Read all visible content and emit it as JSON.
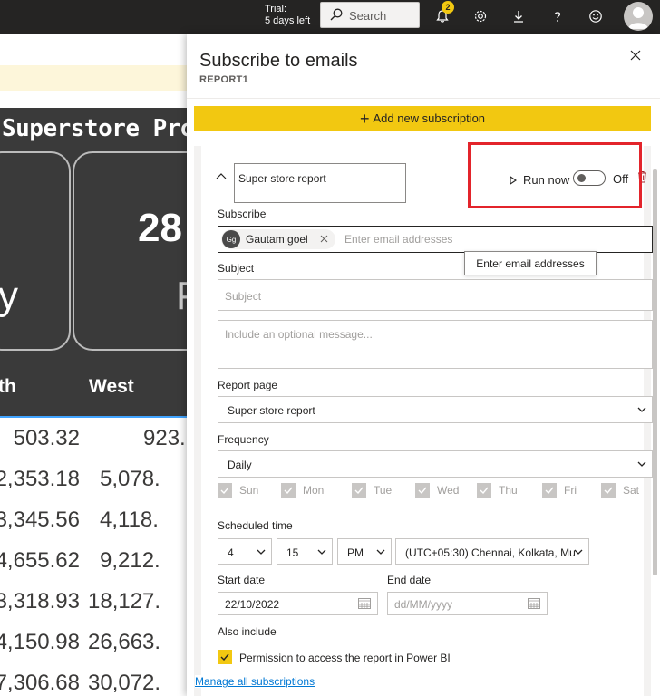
{
  "topbar": {
    "trial_line1": "Trial:",
    "trial_line2": "5 days left",
    "search_label": "Search",
    "notification_count": "2",
    "icons": [
      "bell-icon",
      "gear-icon",
      "download-icon",
      "help-icon",
      "smiley-icon",
      "user-avatar"
    ]
  },
  "report": {
    "title": "Superstore Pro",
    "card_value": "28",
    "card_text_left": "y",
    "card_text_right": "P",
    "headers": [
      "th",
      "West"
    ],
    "rows": [
      [
        "503.32",
        "923."
      ],
      [
        "2,353.18",
        "5,078."
      ],
      [
        "3,345.56",
        "4,118."
      ],
      [
        "4,655.62",
        "9,212."
      ],
      [
        "3,318.93",
        "18,127."
      ],
      [
        "4,150.98",
        "26,663."
      ],
      [
        "7,306.68",
        "30,072."
      ]
    ]
  },
  "panel": {
    "title": "Subscribe to emails",
    "subtitle": "REPORT1",
    "add_button": "Add new subscription",
    "subscription_name": "Super store report",
    "run_now": "Run now",
    "toggle_state": "Off",
    "subscribe_label": "Subscribe",
    "chip_initials": "Gg",
    "chip_name": "Gautam goel",
    "email_placeholder": "Enter email addresses",
    "tooltip": "Enter email addresses",
    "subject_label": "Subject",
    "subject_placeholder": "Subject",
    "message_placeholder": "Include an optional message...",
    "report_page_label": "Report page",
    "report_page_value": "Super store report",
    "frequency_label": "Frequency",
    "frequency_value": "Daily",
    "days": [
      "Sun",
      "Mon",
      "Tue",
      "Wed",
      "Thu",
      "Fri",
      "Sat"
    ],
    "scheduled_time_label": "Scheduled time",
    "hour": "4",
    "minute": "15",
    "ampm": "PM",
    "timezone": "(UTC+05:30) Chennai, Kolkata, Mu",
    "start_date_label": "Start date",
    "start_date_value": "22/10/2022",
    "end_date_label": "End date",
    "end_date_placeholder": "dd/MM/yyyy",
    "also_include_label": "Also include",
    "permission_label": "Permission to access the report in Power BI",
    "manage_link": "Manage all subscriptions"
  },
  "colors": {
    "topbar": "#252423",
    "accent_yellow": "#f2c811",
    "highlight_red": "#e3242b",
    "link_blue": "#0078d4"
  }
}
